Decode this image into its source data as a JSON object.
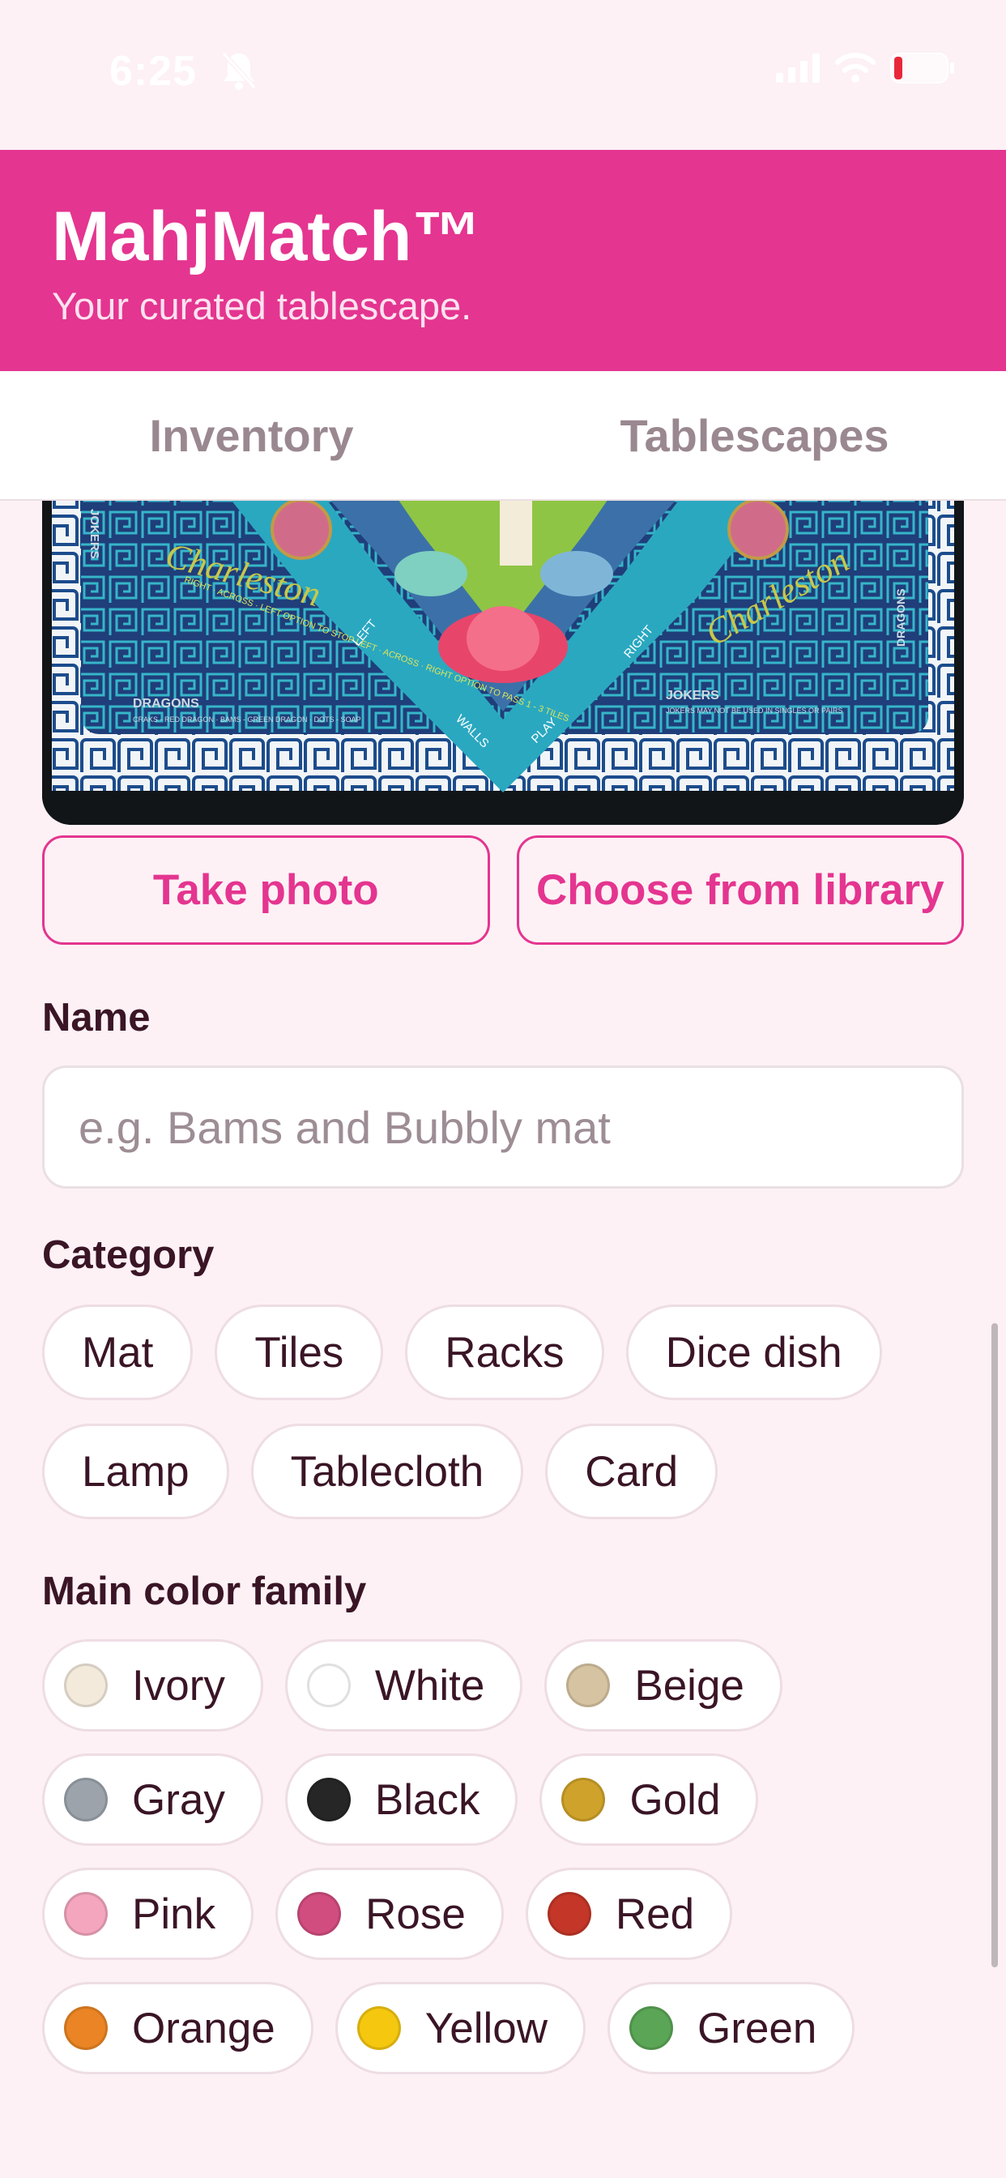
{
  "status_bar": {
    "time": "6:25"
  },
  "header": {
    "title": "MahjMatch™",
    "subtitle": "Your curated tablescape."
  },
  "tabs": [
    {
      "label": "Inventory"
    },
    {
      "label": "Tablescapes"
    }
  ],
  "photo": {
    "mat_texts": {
      "jokers_left": "JOKERS",
      "charleston": "Charleston",
      "rules_left": "RIGHT · ACROSS · LEFT OPTION TO STOP LEFT · ACROSS · RIGHT OPTION TO PASS 1 - 3 TILES",
      "dragons_left": "DRAGONS",
      "dragons_left_sub": "CRAKS - RED DRAGON · BAMS - GREEN DRAGON · DOTS - SOAP",
      "left": "LEFT",
      "walls": "WALLS",
      "play": "PLAY",
      "right": "RIGHT",
      "jokers_right": "JOKERS",
      "jokers_right_sub": "JOKERS MAY NOT BE USED IN SINGLES OR PAIRS",
      "dragons_right": "DRAGONS"
    }
  },
  "actions": {
    "take_photo": "Take photo",
    "choose_library": "Choose from library"
  },
  "form": {
    "name_label": "Name",
    "name_placeholder": "e.g. Bams and Bubbly mat",
    "category_label": "Category",
    "categories": [
      "Mat",
      "Tiles",
      "Racks",
      "Dice dish",
      "Lamp",
      "Tablecloth",
      "Card"
    ],
    "color_label": "Main color family",
    "colors": [
      {
        "name": "Ivory",
        "hex": "#f3eadc"
      },
      {
        "name": "White",
        "hex": "#ffffff"
      },
      {
        "name": "Beige",
        "hex": "#d6c3a1"
      },
      {
        "name": "Gray",
        "hex": "#9ca3ab"
      },
      {
        "name": "Black",
        "hex": "#262626"
      },
      {
        "name": "Gold",
        "hex": "#cfa22b"
      },
      {
        "name": "Pink",
        "hex": "#f4a6be"
      },
      {
        "name": "Rose",
        "hex": "#d24d7f"
      },
      {
        "name": "Red",
        "hex": "#c33628"
      },
      {
        "name": "Orange",
        "hex": "#ea8424"
      },
      {
        "name": "Yellow",
        "hex": "#f5c70f"
      },
      {
        "name": "Green",
        "hex": "#5aa556"
      }
    ]
  },
  "theme": {
    "accent": "#e43590",
    "background": "#fdf1f5",
    "text": "#3a1526"
  }
}
